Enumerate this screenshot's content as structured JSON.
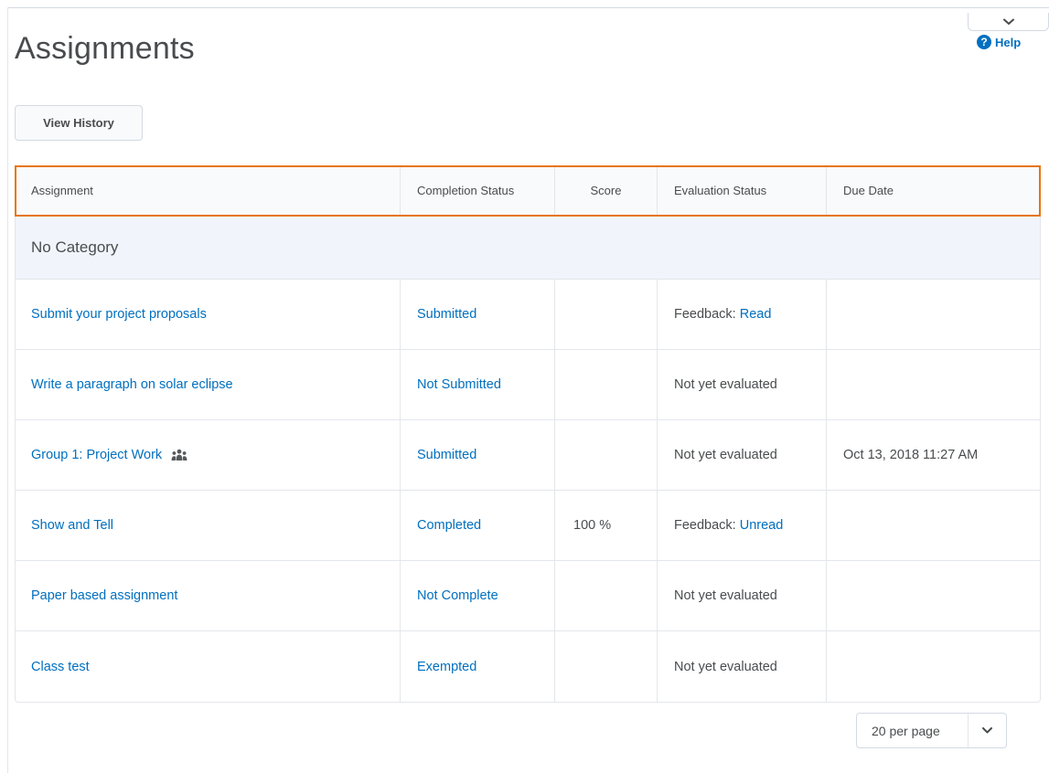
{
  "page": {
    "title": "Assignments",
    "help_label": "Help",
    "view_history_label": "View History"
  },
  "colors": {
    "link": "#006fbf",
    "text": "#494c4e",
    "header_outline": "#e87511",
    "category_bg": "#f1f5fb"
  },
  "icons": {
    "collapse": "chevron-down-icon",
    "help": "question-circle-icon",
    "group": "group-icon",
    "pager": "chevron-down-icon"
  },
  "table": {
    "columns": [
      "Assignment",
      "Completion Status",
      "Score",
      "Evaluation Status",
      "Due Date"
    ],
    "category": "No Category",
    "rows": [
      {
        "assignment": "Submit your project proposals",
        "completion": "Submitted",
        "score": "",
        "eval_prefix": "Feedback:",
        "eval_link": "Read",
        "eval_text": "",
        "due": ""
      },
      {
        "assignment": "Write a paragraph on solar eclipse",
        "completion": "Not Submitted",
        "score": "",
        "eval_prefix": "",
        "eval_link": "",
        "eval_text": "Not yet evaluated",
        "due": ""
      },
      {
        "assignment": "Group 1: Project Work",
        "completion": "Submitted",
        "score": "",
        "eval_prefix": "",
        "eval_link": "",
        "eval_text": "Not yet evaluated",
        "due": "Oct 13, 2018 11:27 AM"
      },
      {
        "assignment": "Show and Tell",
        "completion": "Completed",
        "score": "100 %",
        "eval_prefix": "Feedback:",
        "eval_link": "Unread",
        "eval_text": "",
        "due": ""
      },
      {
        "assignment": "Paper based assignment",
        "completion": "Not Complete",
        "score": "",
        "eval_prefix": "",
        "eval_link": "",
        "eval_text": "Not yet evaluated",
        "due": ""
      },
      {
        "assignment": "Class test",
        "completion": "Exempted",
        "score": "",
        "eval_prefix": "",
        "eval_link": "",
        "eval_text": "Not yet evaluated",
        "due": ""
      }
    ]
  },
  "pager": {
    "selected": "20 per page"
  }
}
